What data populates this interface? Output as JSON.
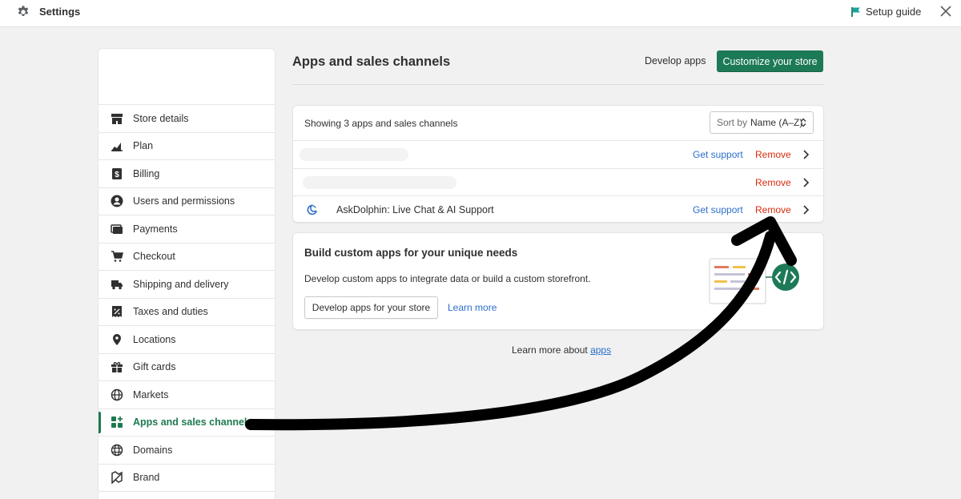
{
  "topbar": {
    "title": "Settings",
    "setup_guide": "Setup guide",
    "icons": {
      "settings": "gear-icon",
      "setup": "flag-icon",
      "close": "close-icon"
    }
  },
  "sidebar": {
    "items": [
      {
        "label": "Store details",
        "icon": "store-icon"
      },
      {
        "label": "Plan",
        "icon": "plan-icon"
      },
      {
        "label": "Billing",
        "icon": "billing-icon"
      },
      {
        "label": "Users and permissions",
        "icon": "user-icon"
      },
      {
        "label": "Payments",
        "icon": "payments-icon"
      },
      {
        "label": "Checkout",
        "icon": "cart-icon"
      },
      {
        "label": "Shipping and delivery",
        "icon": "truck-icon"
      },
      {
        "label": "Taxes and duties",
        "icon": "tax-icon"
      },
      {
        "label": "Locations",
        "icon": "location-icon"
      },
      {
        "label": "Gift cards",
        "icon": "gift-icon"
      },
      {
        "label": "Markets",
        "icon": "globe-icon"
      },
      {
        "label": "Apps and sales channels",
        "icon": "apps-icon",
        "active": true
      },
      {
        "label": "Domains",
        "icon": "domains-icon"
      },
      {
        "label": "Brand",
        "icon": "brand-icon"
      }
    ]
  },
  "header": {
    "title": "Apps and sales channels",
    "develop_apps": "Develop apps",
    "customize": "Customize your store"
  },
  "apps": {
    "count_text": "Showing 3 apps and sales channels",
    "sort_prefix": "Sort by",
    "sort_value": "Name (A–Z)",
    "rows": [
      {
        "name": "",
        "get_support": "Get support",
        "remove": "Remove"
      },
      {
        "name": "",
        "remove": "Remove"
      },
      {
        "name": "AskDolphin: Live Chat & AI Support",
        "get_support": "Get support",
        "remove": "Remove"
      }
    ]
  },
  "build": {
    "title": "Build custom apps for your unique needs",
    "description": "Develop custom apps to integrate data or build a custom storefront.",
    "button": "Develop apps for your store",
    "learn_more": "Learn more"
  },
  "footer": {
    "prefix": "Learn more about ",
    "link": "apps"
  },
  "colors": {
    "primary_button": "#1d7a57",
    "active_nav": "#1e7a4f",
    "link": "#2c6ecb",
    "remove": "#d82c0d"
  }
}
